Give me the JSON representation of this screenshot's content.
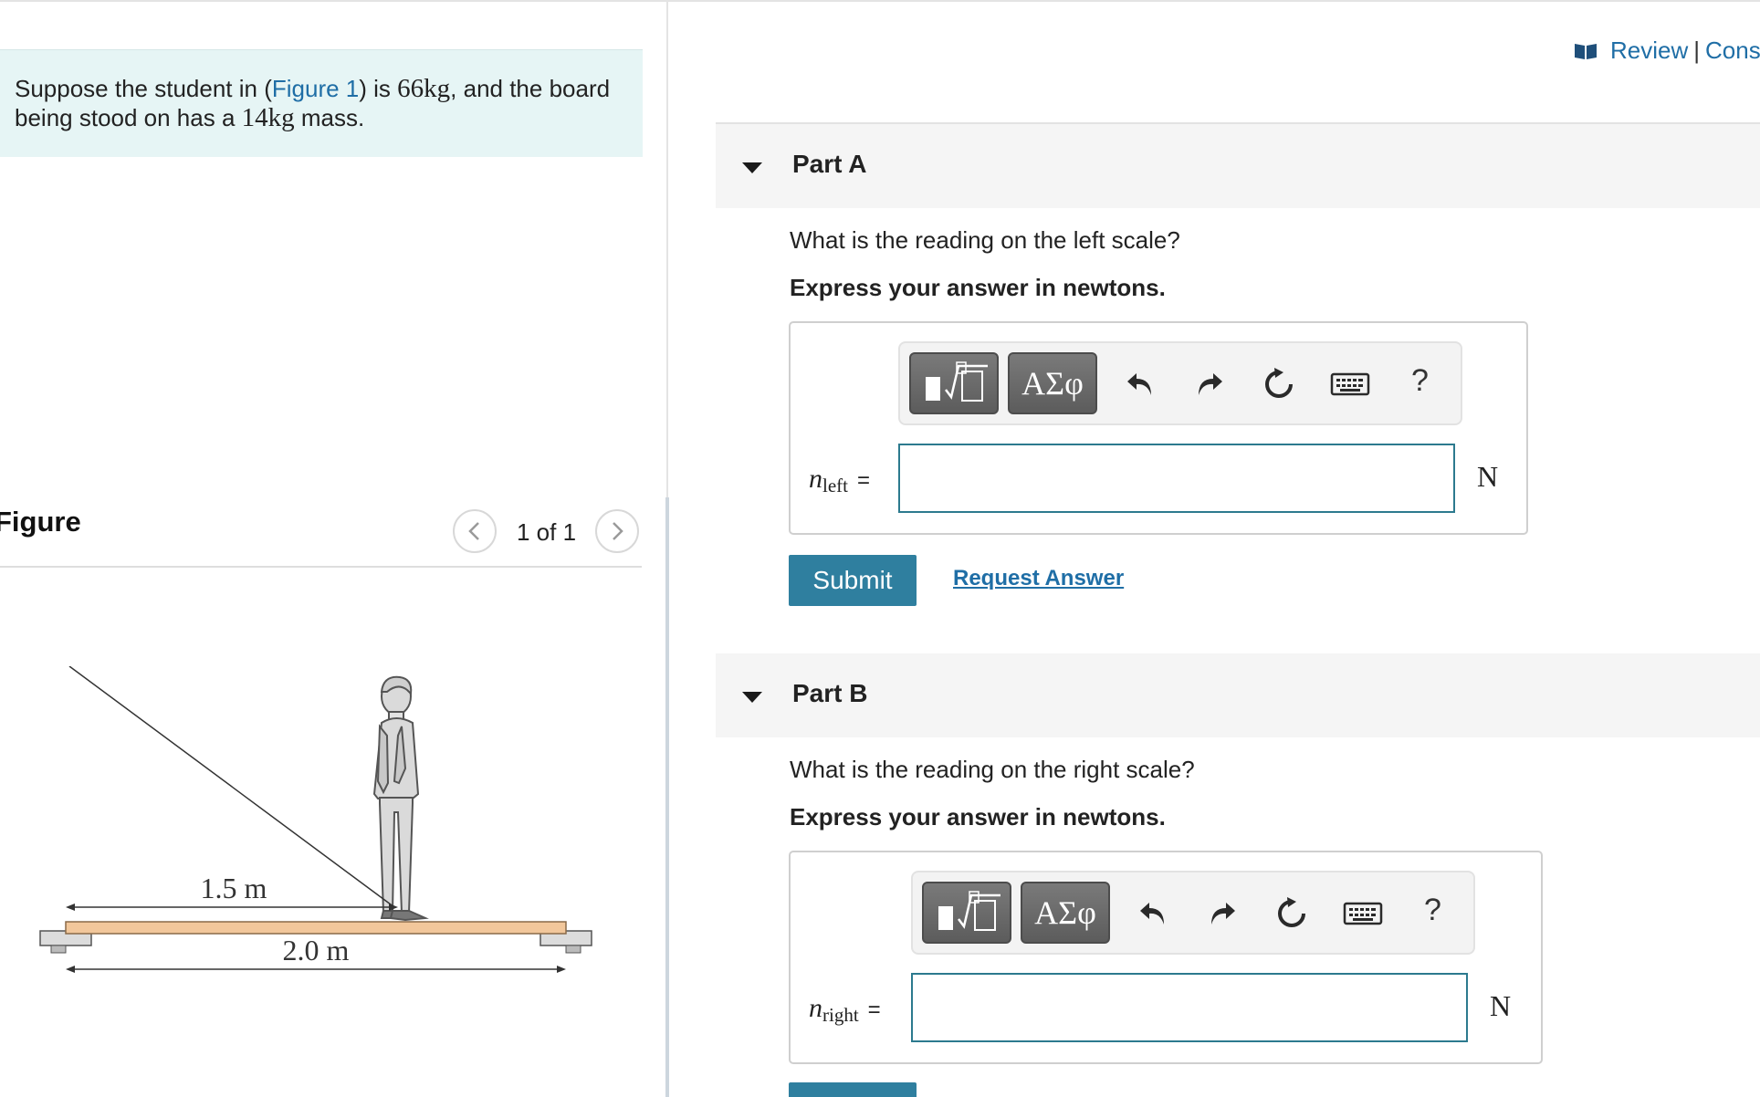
{
  "problem": {
    "text_before": "Suppose the student in (",
    "figure_link": "Figure 1",
    "text_mid1": ") is ",
    "student_mass": "66kg",
    "text_mid2": ", and the board being stood on has a ",
    "board_mass": "14kg",
    "text_after": " mass."
  },
  "figure_panel": {
    "title": "Figure",
    "pager": "1 of 1",
    "dim_short": "1.5 m",
    "dim_long": "2.0 m"
  },
  "header": {
    "review_label": "Review",
    "divider": "|",
    "constants_label": "Cons"
  },
  "part_a": {
    "title": "Part A",
    "question": "What is the reading on the left scale?",
    "instruction": "Express your answer in newtons.",
    "toolbar_greek": "ΑΣφ",
    "help": "?",
    "var": "n",
    "var_sub": "left",
    "equals": "=",
    "value": "",
    "unit": "N",
    "submit": "Submit",
    "request": "Request Answer"
  },
  "part_b": {
    "title": "Part B",
    "question": "What is the reading on the right scale?",
    "instruction": "Express your answer in newtons.",
    "toolbar_greek": "ΑΣφ",
    "help": "?",
    "var": "n",
    "var_sub": "right",
    "equals": "=",
    "value": "",
    "unit": "N"
  },
  "colors": {
    "accent": "#2f7f9f",
    "link": "#1f6ea6",
    "input_border": "#2c7a8e",
    "problem_bg": "#e6f5f5"
  },
  "icons": [
    "book-icon",
    "chevron-left-icon",
    "chevron-right-icon",
    "caret-down-icon",
    "templates-icon",
    "undo-icon",
    "redo-icon",
    "reset-icon",
    "keyboard-icon",
    "help-icon"
  ]
}
